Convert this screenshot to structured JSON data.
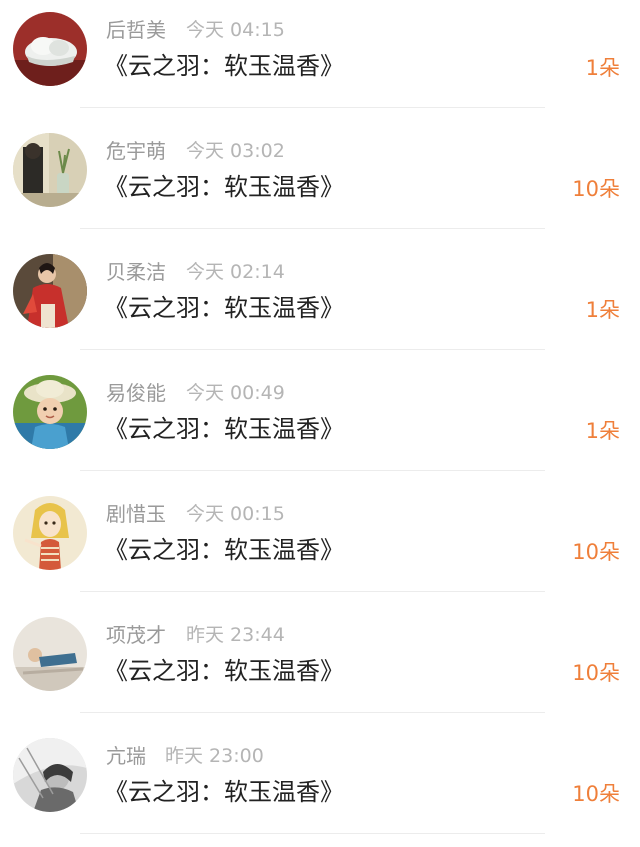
{
  "items": [
    {
      "name": "后哲美",
      "time": "今天 04:15",
      "title": "《云之羽：软玉温香》",
      "count": "1朵",
      "avatar": "white-flower-sculpture-avatar"
    },
    {
      "name": "危宇萌",
      "time": "今天 03:02",
      "title": "《云之羽：软玉温香》",
      "count": "10朵",
      "avatar": "girl-with-vase-avatar"
    },
    {
      "name": "贝柔洁",
      "time": "今天 02:14",
      "title": "《云之羽：软玉温香》",
      "count": "1朵",
      "avatar": "woman-in-red-avatar"
    },
    {
      "name": "易俊能",
      "time": "今天 00:49",
      "title": "《云之羽：软玉温香》",
      "count": "1朵",
      "avatar": "child-with-hat-avatar"
    },
    {
      "name": "剧惜玉",
      "time": "今天 00:15",
      "title": "《云之羽：软玉温香》",
      "count": "10朵",
      "avatar": "cartoon-girl-avatar"
    },
    {
      "name": "项茂才",
      "time": "昨天 23:44",
      "title": "《云之羽：软玉温香》",
      "count": "10朵",
      "avatar": "person-lying-avatar"
    },
    {
      "name": "亢瑞",
      "time": "昨天 23:00",
      "title": "《云之羽：软玉温香》",
      "count": "10朵",
      "avatar": "grayscale-portrait-avatar"
    }
  ],
  "colors": {
    "accent": "#ef7f3a",
    "name": "#9a9a9a",
    "time": "#b5b5b5",
    "title": "#222222"
  }
}
